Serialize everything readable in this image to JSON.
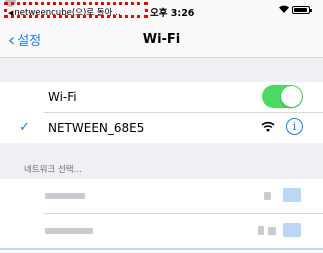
{
  "status_bar": {
    "back_app_indicator": "◀",
    "back_app_label": "netweencube(으)로 돌아...",
    "time": "오후 3:26"
  },
  "nav": {
    "back_label": "설정",
    "title": "Wi-Fi"
  },
  "wifi_row": {
    "label": "Wi-Fi",
    "toggle_on": true
  },
  "connected_network": {
    "name": "NETWEEN_68E5",
    "checkmark": "✓",
    "info_glyph": "i"
  },
  "section_header": "네트워크 선택...",
  "colors": {
    "accent": "#1a7cf5",
    "toggle_on": "#4cd964",
    "highlight_border": "#e10b0b"
  },
  "icons": [
    "chevron-left-icon",
    "wifi-icon",
    "info-icon",
    "checkmark-icon",
    "battery-icon"
  ]
}
